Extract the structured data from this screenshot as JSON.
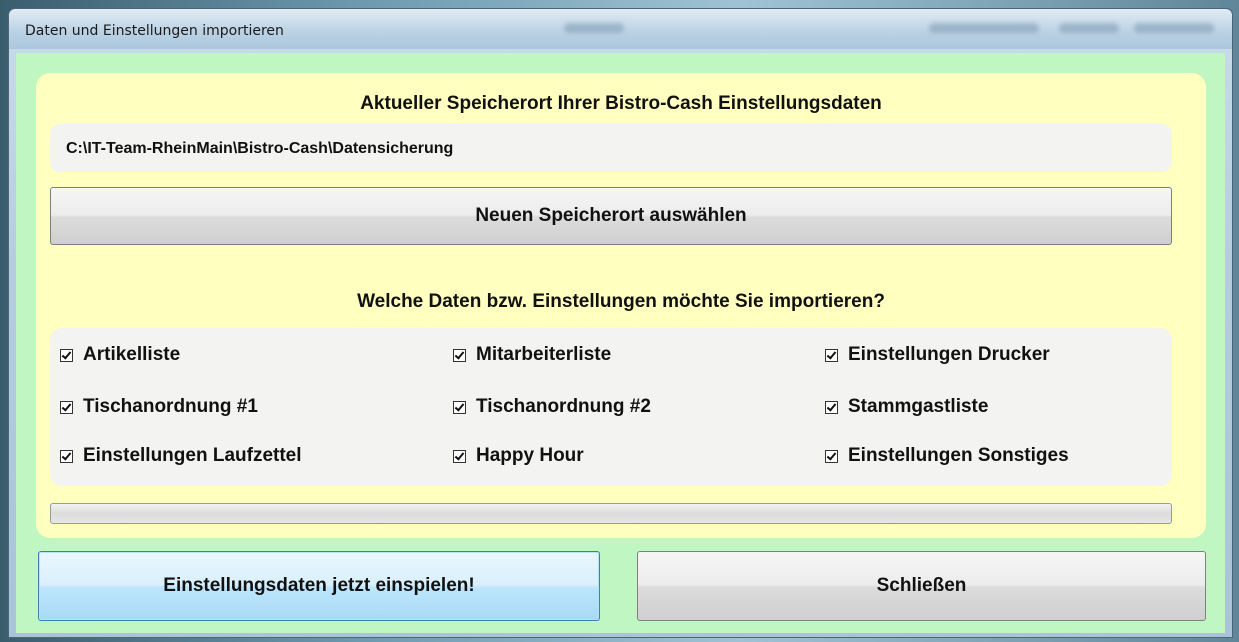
{
  "window": {
    "title": "Daten und Einstellungen importieren"
  },
  "storage": {
    "heading": "Aktueller Speicherort Ihrer Bistro-Cash Einstellungsdaten",
    "path": "C:\\IT-Team-RheinMain\\Bistro-Cash\\Datensicherung",
    "choose_button": "Neuen Speicherort auswählen"
  },
  "import": {
    "heading": "Welche Daten bzw. Einstellungen möchte Sie importieren?",
    "options": [
      {
        "label": "Artikelliste",
        "checked": true
      },
      {
        "label": "Mitarbeiterliste",
        "checked": true
      },
      {
        "label": "Einstellungen Drucker",
        "checked": true
      },
      {
        "label": "Tischanordnung #1",
        "checked": true
      },
      {
        "label": "Tischanordnung #2",
        "checked": true
      },
      {
        "label": "Stammgastliste",
        "checked": true
      },
      {
        "label": "Einstellungen Laufzettel",
        "checked": true
      },
      {
        "label": "Happy Hour",
        "checked": true
      },
      {
        "label": "Einstellungen Sonstiges",
        "checked": true
      }
    ],
    "progress": 0
  },
  "buttons": {
    "import_now": "Einstellungsdaten jetzt einspielen!",
    "close": "Schließen"
  },
  "colors": {
    "client_bg": "#bff6c2",
    "panel_bg": "#ffffc0",
    "inner_box_bg": "#f3f3f1"
  }
}
